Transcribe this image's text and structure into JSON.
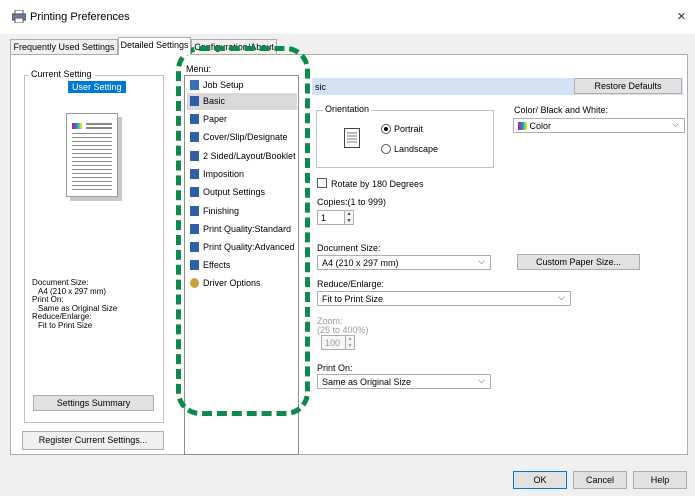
{
  "window": {
    "title": "Printing Preferences",
    "close_glyph": "×"
  },
  "tabs": [
    {
      "label": "Frequently Used Settings"
    },
    {
      "label": "Detailed Settings"
    },
    {
      "label": "Configuration/About"
    }
  ],
  "current_setting": {
    "group_label": "Current Setting",
    "selected": "User Setting",
    "summary": {
      "document_size_label": "Document Size:",
      "document_size_value": "A4 (210 x 297 mm)",
      "print_on_label": "Print On:",
      "print_on_value": "Same as Original Size",
      "reduce_label": "Reduce/Enlarge:",
      "reduce_value": "Fit to Print Size"
    },
    "summary_button": "Settings Summary",
    "register_button": "Register Current Settings..."
  },
  "menu": {
    "label": "Menu:",
    "items": [
      {
        "label": "Job Setup",
        "icon": "job-setup-icon"
      },
      {
        "label": "Basic",
        "icon": "basic-icon"
      },
      {
        "label": "Paper",
        "icon": "paper-icon"
      },
      {
        "label": "Cover/Slip/Designate",
        "icon": "cover-icon"
      },
      {
        "label": "2 Sided/Layout/Booklet",
        "icon": "duplex-icon"
      },
      {
        "label": "Imposition",
        "icon": "imposition-icon"
      },
      {
        "label": "Output Settings",
        "icon": "output-icon"
      },
      {
        "label": "Finishing",
        "icon": "finishing-icon"
      },
      {
        "label": "Print Quality:Standard",
        "icon": "quality-standard-icon"
      },
      {
        "label": "Print Quality:Advanced",
        "icon": "quality-advanced-icon"
      },
      {
        "label": "Effects",
        "icon": "effects-icon"
      },
      {
        "label": "Driver Options",
        "icon": "driver-options-icon"
      }
    ]
  },
  "basic": {
    "header_label": "sic",
    "restore_button": "Restore Defaults",
    "orientation": {
      "label": "Orientation",
      "portrait": "Portrait",
      "landscape": "Landscape"
    },
    "color": {
      "label": "Color/ Black and White:",
      "value": "Color"
    },
    "rotate_label": "Rotate by 180 Degrees",
    "copies": {
      "label": "Copies:(1 to 999)",
      "value": "1"
    },
    "document_size": {
      "label": "Document Size:",
      "value": "A4 (210 x 297 mm)"
    },
    "custom_paper_button": "Custom Paper Size...",
    "reduce_enlarge": {
      "label": "Reduce/Enlarge:",
      "value": "Fit to Print Size"
    },
    "zoom": {
      "label": "Zoom:",
      "range": "(25 to 400%)",
      "value": "100"
    },
    "print_on": {
      "label": "Print On:",
      "value": "Same as Original Size"
    }
  },
  "footer": {
    "ok": "OK",
    "cancel": "Cancel",
    "help": "Help"
  },
  "colors": {
    "highlight_dash": "#0f8a4d",
    "selection": "#0078d7",
    "menu_selection": "#d9d9d9"
  }
}
